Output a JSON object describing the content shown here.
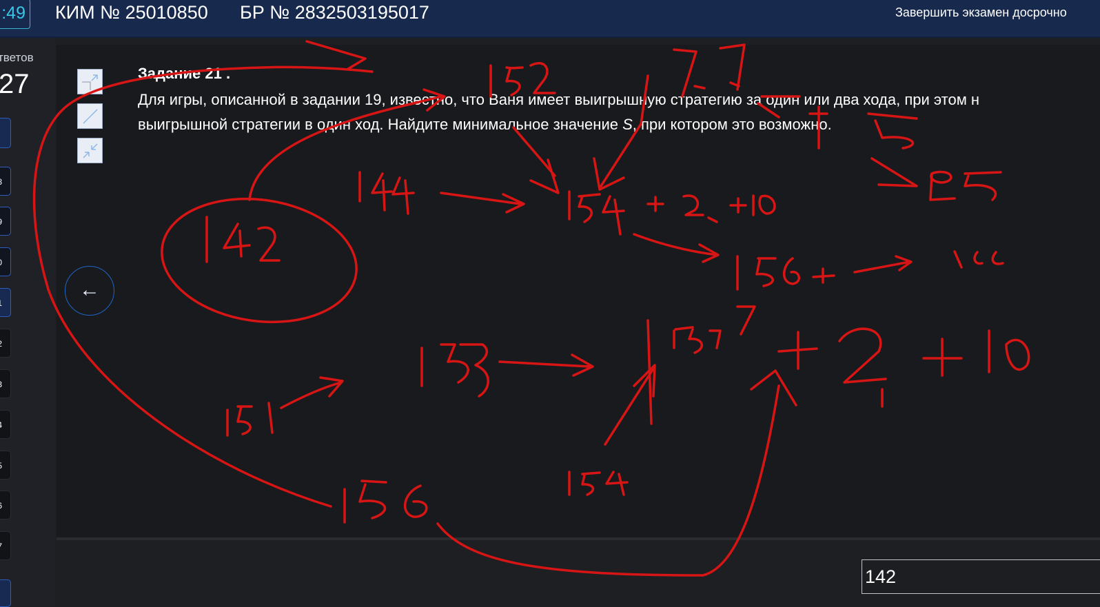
{
  "header": {
    "timer": ":49",
    "kim": "КИМ № 25010850",
    "br": "БР № 2832503195017",
    "finish_label": "Завершить экзамен досрочно"
  },
  "sidebar": {
    "answers_label": "тветов",
    "answers_count": "27",
    "items": [
      "8",
      "9",
      "0",
      "1",
      "2",
      "3",
      "4",
      "5",
      "6",
      "7"
    ]
  },
  "task": {
    "title": "Задание 21 .",
    "line1": "Для игры, описанной в задании 19, известно, что Ваня имеет выигрышную стратегию за один или два хода, при этом н",
    "line2_before": "выигрышной стратегии в один ход. Найдите минимальное значение ",
    "line2_var": "S",
    "line2_after": ", при котором это возможно."
  },
  "icons": {
    "expand": "expand-icon",
    "fullscreen": "fullscreen-icon",
    "collapse": "collapse-icon",
    "back": "←"
  },
  "answer": {
    "value": "142"
  },
  "colors": {
    "header_bg": "#17294c",
    "panel_bg": "#181a1d",
    "accent": "#2e5fbf",
    "timer": "#39c6e8",
    "ink": "#d81515"
  }
}
